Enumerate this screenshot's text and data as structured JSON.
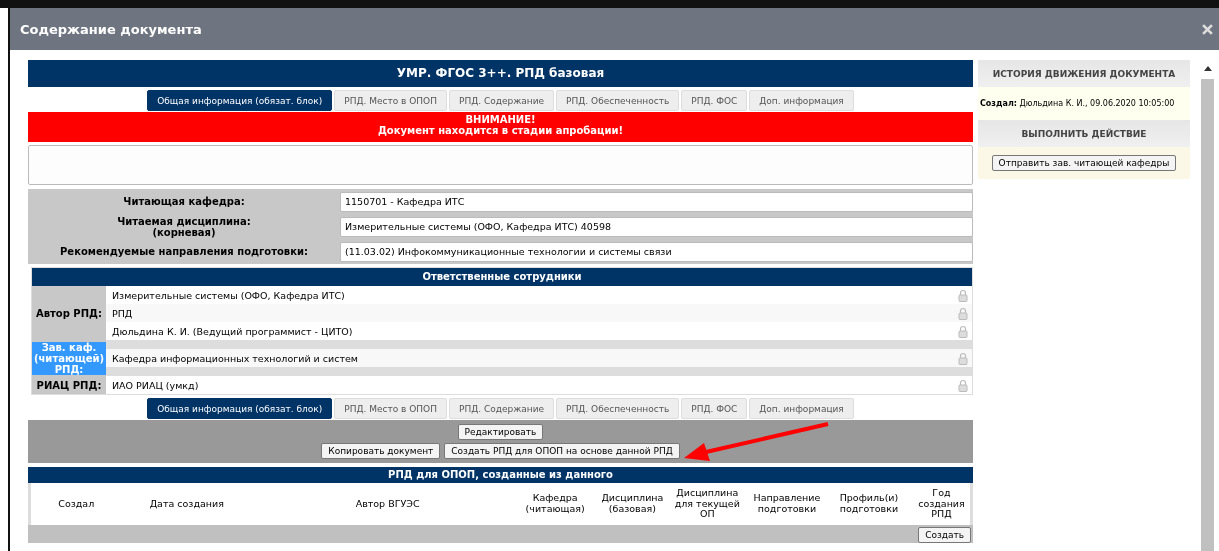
{
  "window": {
    "title": "Содержание документа"
  },
  "document": {
    "title": "УМР. ФГОС 3++. РПД базовая",
    "tabs": [
      {
        "label": "Общая информация (обязат. блок)",
        "selected": true
      },
      {
        "label": "РПД. Место в ОПОП",
        "selected": false
      },
      {
        "label": "РПД. Содержание",
        "selected": false
      },
      {
        "label": "РПД. Обеспеченность",
        "selected": false
      },
      {
        "label": "РПД. ФОС",
        "selected": false
      },
      {
        "label": "Доп. информация",
        "selected": false
      }
    ],
    "alert": [
      "ВНИМАНИЕ!",
      "Документ находится в стадии апробации!"
    ],
    "fields": [
      {
        "label": "Читающая кафедра:",
        "value": "1150701 - Кафедра ИТС"
      },
      {
        "label": "Читаемая дисциплина:\n(корневая)",
        "value": "Измерительные системы (ОФО, Кафедра ИТС) 40598"
      },
      {
        "label": "Рекомендуемые направления подготовки:",
        "value": "(11.03.02) Инфокоммуникационные технологии и системы связи"
      }
    ],
    "responsible": {
      "title": "Ответственные сотрудники",
      "groups": [
        {
          "label": "Автор РПД:",
          "highlighted": false,
          "rows": [
            {
              "kind": "entry",
              "text": "Измерительные системы (ОФО, Кафедра ИТС)"
            },
            {
              "kind": "entry",
              "text": "РПД"
            },
            {
              "kind": "entry",
              "text": "Дюльдина К. И. (Ведущий программист - ЦИТО)"
            }
          ]
        },
        {
          "label": "Зав. каф. (читающей) РПД:",
          "highlighted": true,
          "rows": [
            {
              "kind": "blank"
            },
            {
              "kind": "entry",
              "text": "Кафедра информационных технологий и систем"
            },
            {
              "kind": "blank"
            }
          ]
        },
        {
          "label": "РИАЦ РПД:",
          "highlighted": false,
          "rows": [
            {
              "kind": "entry",
              "text": "ИАО РИАЦ (умкд)"
            }
          ]
        }
      ]
    },
    "bottom_tabs": [
      {
        "label": "Общая информация (обязат. блок)",
        "selected": true
      },
      {
        "label": "РПД. Место в ОПОП",
        "selected": false
      },
      {
        "label": "РПД. Содержание",
        "selected": false
      },
      {
        "label": "РПД. Обеспеченность",
        "selected": false
      },
      {
        "label": "РПД. ФОС",
        "selected": false
      },
      {
        "label": "Доп. информация",
        "selected": false
      }
    ],
    "actions": {
      "edit": "Редактировать",
      "copy": "Копировать документ",
      "create_from": "Создать РПД для ОПОП на основе данной РПД"
    },
    "derived": {
      "title": "РПД для ОПОП, созданные из данного",
      "columns": [
        "Создал",
        "Дата создания",
        "Автор ВГУЭС",
        "Кафедра (читающая)",
        "Дисциплина (базовая)",
        "Дисциплина для текущей ОП",
        "Направление подготовки",
        "Профиль(и) подготовки",
        "Год создания РПД"
      ],
      "create_button": "Создать"
    }
  },
  "side": {
    "history_title": "ИСТОРИЯ ДВИЖЕНИЯ ДОКУМЕНТА",
    "created_label": "Создал:",
    "created_value": "Дюльдина К. И., 09.06.2020 10:05:00",
    "action_title": "ВЫПОЛНИТЬ ДЕЙСТВИЕ",
    "action_button": "Отправить зав. читающей кафедры"
  }
}
